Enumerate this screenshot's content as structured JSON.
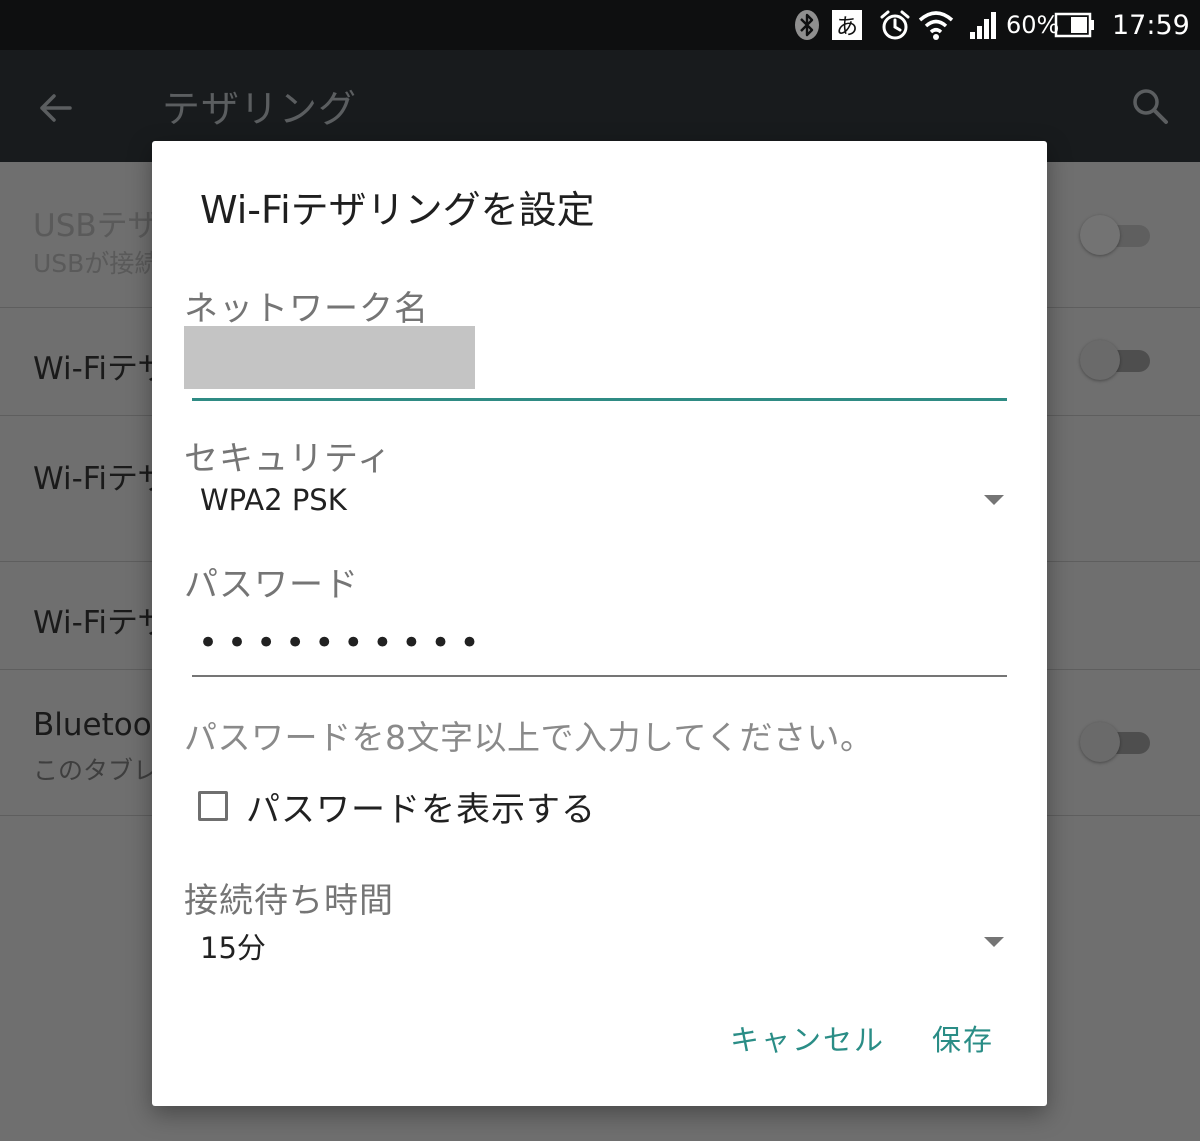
{
  "status_bar": {
    "ime_label": "あ",
    "battery_percent": "60%",
    "time": "17:59",
    "icons": [
      "bluetooth-icon",
      "ime-icon",
      "alarm-icon",
      "wifi-icon",
      "signal-icon",
      "battery-icon"
    ]
  },
  "app_bar": {
    "title": "テザリング",
    "icons": [
      "back-arrow-icon",
      "search-icon"
    ]
  },
  "background_list": {
    "items": [
      {
        "title": "USBテザ",
        "subtitle": "USBが接続",
        "toggle": "off"
      },
      {
        "title": "Wi-Fiテザ",
        "toggle": "off"
      },
      {
        "title": "Wi-Fiテザ"
      },
      {
        "title": "Wi-Fiテザ"
      },
      {
        "title": "Bluetoot",
        "subtitle": "このタブレ",
        "toggle": "off"
      }
    ]
  },
  "dialog": {
    "title": "Wi-Fiテザリングを設定",
    "network_name_label": "ネットワーク名",
    "security_label": "セキュリティ",
    "security_value": "WPA2 PSK",
    "password_label": "パスワード",
    "password_value": "••••••••••",
    "password_hint": "パスワードを8文字以上で入力してください。",
    "show_password_label": "パスワードを表示する",
    "show_password_checked": false,
    "timeout_label": "接続待ち時間",
    "timeout_value": "15分",
    "cancel_label": "キャンセル",
    "save_label": "保存"
  },
  "colors": {
    "accent": "#2a8d86",
    "dialog_bg": "#ffffff",
    "scrim": "#6f6f6f",
    "status_bar": "#0e0f10",
    "app_bar": "#181b1d"
  }
}
